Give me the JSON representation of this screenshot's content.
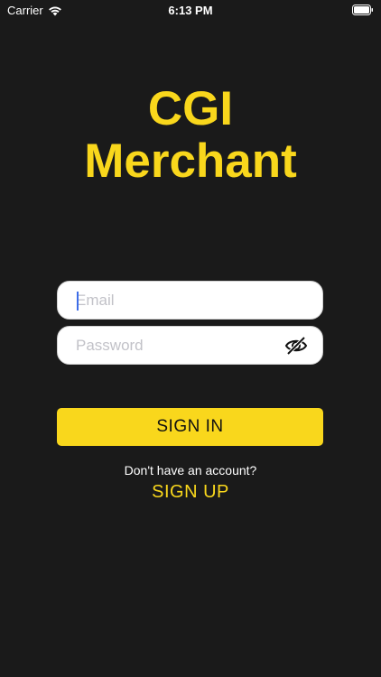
{
  "status_bar": {
    "carrier": "Carrier",
    "time": "6:13 PM",
    "wifi_icon": "wifi-icon",
    "battery_icon": "battery-icon"
  },
  "app": {
    "title_line1": "CGI",
    "title_line2": "Merchant",
    "accent_color": "#f9d71c",
    "background_color": "#1a1a1a"
  },
  "form": {
    "email_placeholder": "Email",
    "email_value": "",
    "password_placeholder": "Password",
    "password_value": "",
    "password_toggle_icon": "eye-slash-icon",
    "signin_label": "SIGN IN"
  },
  "footer": {
    "no_account_text": "Don't have an account?",
    "signup_label": "SIGN UP"
  }
}
